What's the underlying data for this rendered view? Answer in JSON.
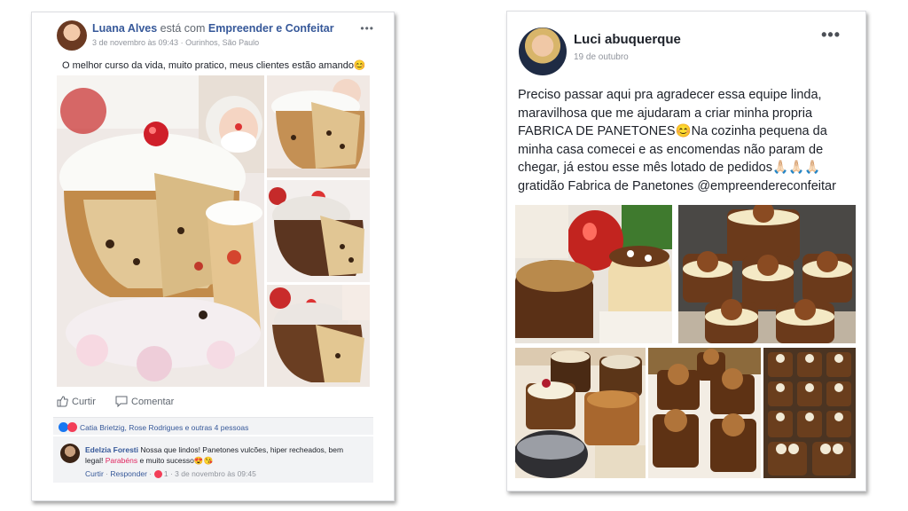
{
  "post1": {
    "author": "Luana Alves",
    "with_text": "está com",
    "page": "Empreender e Confeitar",
    "meta": "3 de novembro às 09:43 · Ourinhos, São Paulo",
    "more": "•••",
    "text": "O melhor curso da vida, muito pratico, meus clientes estão amando😊",
    "like_label": "Curtir",
    "comment_label": "Comentar",
    "reactions": "Catia Brietzig, Rose Rodrigues e outras 4 pessoas",
    "comment": {
      "author": "Edelzia Foresti",
      "text_before": "Nossa que lindos! Panetones vulcões, hiper recheados, bem legal!",
      "highlight": "Parabéns",
      "text_after": "e muito sucesso😍😘",
      "reply_like": "Curtir",
      "reply": "Responder",
      "reaction_count": "1",
      "time": "3 de novembro às 09:45"
    }
  },
  "post2": {
    "author": "Luci abuquerque",
    "date": "19 de outubro",
    "more": "•••",
    "text": "Preciso passar aqui pra agradecer essa equipe linda, maravilhosa que me ajudaram a criar minha propria FABRICA DE PANETONES😊Na cozinha pequena da minha casa comecei e as encomendas não param de chegar, já estou esse mês lotado de pedidos🙏🏻🙏🏻🙏🏻 gratidão Fabrica de Panetones @empreendereconfeitar"
  },
  "colors": {
    "link_blue": "#365899",
    "like_blue": "#1877f2",
    "love_red": "#f33e58",
    "text_dark": "#1d2129",
    "meta_gray": "#90949c"
  }
}
